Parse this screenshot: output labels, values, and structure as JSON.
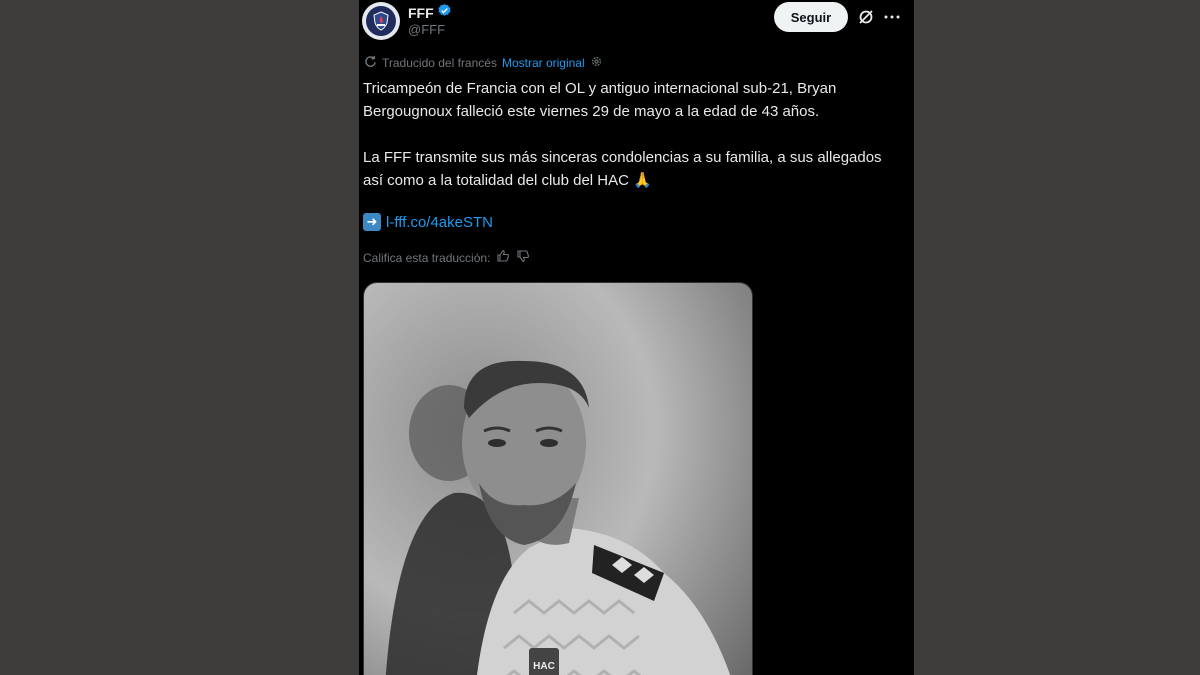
{
  "account": {
    "name": "FFF",
    "handle": "@FFF",
    "verified": true,
    "verified_color": "#1d9bf0"
  },
  "actions": {
    "follow_label": "Seguir"
  },
  "translation": {
    "note": "Traducido del francés",
    "show_original": "Mostrar original"
  },
  "tweet": {
    "paragraph1": "Tricampeón de Francia con el OL y antiguo internacional sub-21, Bryan Bergougnoux falleció este viernes 29 de mayo a la edad de 43 años.",
    "paragraph2": "La FFF transmite sus más sinceras condolencias a su familia, a sus allegados así como a la totalidad del club del HAC 🙏",
    "link_text": "l-fff.co/4akeSTN"
  },
  "rating": {
    "label": "Califica esta traducción:"
  },
  "media": {
    "badge_text": "HAC"
  },
  "colors": {
    "background": "#3e3d3c",
    "card": "#000000",
    "text": "#e7e9ea",
    "muted": "#71767b",
    "link": "#1d9bf0"
  }
}
